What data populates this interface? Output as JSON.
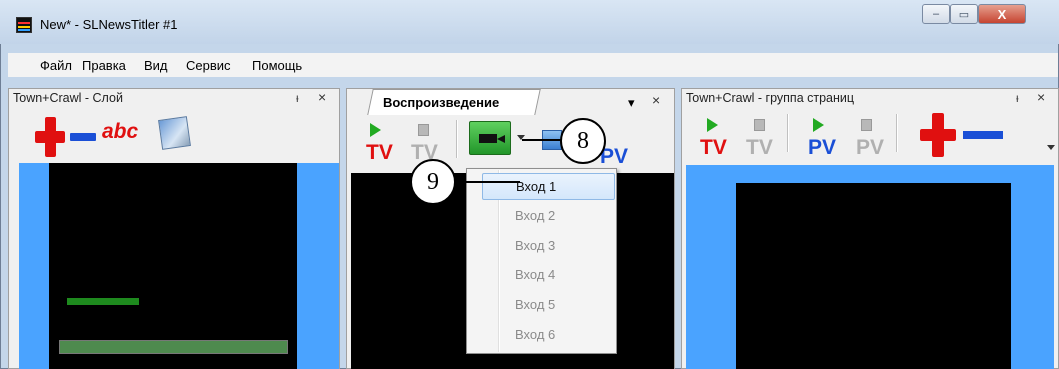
{
  "window": {
    "title": "New* - SLNewsTitler #1",
    "buttons": {
      "minimize": "‒",
      "maximize": "▭",
      "close": "X"
    }
  },
  "menu": [
    "Файл",
    "Правка",
    "Вид",
    "Сервис",
    "Помощь"
  ],
  "panels": {
    "layer": {
      "title": "Town+Crawl - Слой",
      "pin": "ᵼ",
      "close": "×",
      "abc_label": "abc"
    },
    "playback": {
      "tab_label": "Воспроизведение",
      "menu_arrow": "▾",
      "close": "×",
      "tv": "TV",
      "pv": "PV"
    },
    "group": {
      "title": "Town+Crawl - группа страниц",
      "pin": "ᵼ",
      "close": "×",
      "tv": "TV",
      "pv": "PV"
    }
  },
  "input_dropdown": {
    "selected": "Вход 1",
    "items": [
      "Вход 1",
      "Вход 2",
      "Вход 3",
      "Вход 4",
      "Вход 5",
      "Вход 6"
    ]
  },
  "callouts": {
    "camera_button": "8",
    "selected_item": "9"
  },
  "colors": {
    "accent_red": "#e01010",
    "accent_blue": "#1a4fd6",
    "play_green": "#22aa22",
    "preview_blue": "#4aa3ff",
    "crawl_green": "#1e8a1e"
  }
}
